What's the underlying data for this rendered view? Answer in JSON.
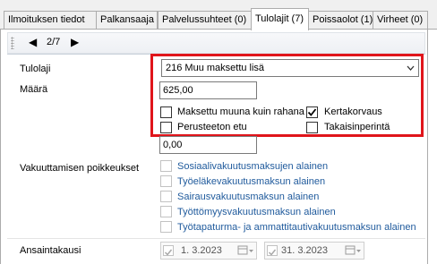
{
  "tabs": [
    {
      "label": "Ilmoituksen tiedot",
      "active": false
    },
    {
      "label": "Palkansaaja",
      "active": false
    },
    {
      "label": "Palvelussuhteet (0)",
      "active": false
    },
    {
      "label": "Tulolajit (7)",
      "active": true
    },
    {
      "label": "Poissaolot (1)",
      "active": false
    },
    {
      "label": "Virheet (0)",
      "active": false
    }
  ],
  "nav": {
    "prev_icon": "◀",
    "next_icon": "▶",
    "pager_text": "2/7"
  },
  "form": {
    "tulolaji_label": "Tulolaji",
    "tulolaji_value": "216 Muu maksettu lisä",
    "maara_label": "Määrä",
    "maara_value": "625,00",
    "second_value": "0,00",
    "checkboxes": {
      "maksettu_muuna": {
        "label": "Maksettu muuna kuin rahana",
        "checked": false
      },
      "kertakorvaus": {
        "label": "Kertakorvaus",
        "checked": true
      },
      "perusteeton_etu": {
        "label": "Perusteeton etu",
        "checked": false
      },
      "takaisinperinta": {
        "label": "Takaisinperintä",
        "checked": false
      }
    },
    "vakuuttamisen_label": "Vakuuttamisen poikkeukset",
    "exceptions": [
      "Sosiaalivakuutusmaksujen alainen",
      "Työeläkevakuutusmaksun alainen",
      "Sairausvakuutusmaksun alainen",
      "Työttömyysvakuutusmaksun alainen",
      "Työtapaturma- ja ammattitautivakuutusmaksun alainen"
    ],
    "ansaintakausi_label": "Ansaintakausi",
    "start_date": "1. 3.2023",
    "end_date": "31. 3.2023"
  },
  "colors": {
    "highlight_border": "#e0151b",
    "exception_text": "#1f5a9c"
  }
}
